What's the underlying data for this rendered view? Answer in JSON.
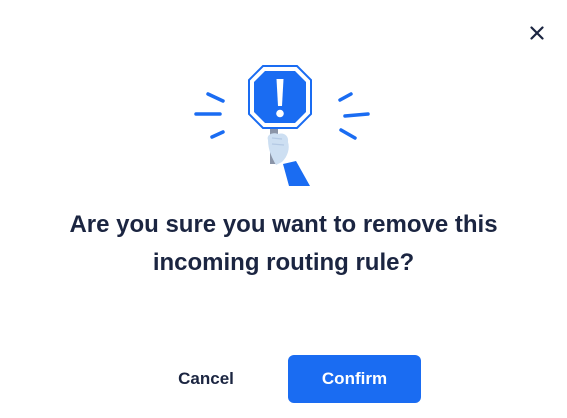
{
  "dialog": {
    "title": "Are you sure you want to remove this incoming routing rule?",
    "cancel_label": "Cancel",
    "confirm_label": "Confirm",
    "close_icon": "close-icon",
    "illustration_icon": "warning-sign-icon"
  },
  "colors": {
    "primary": "#1a6cf2",
    "text": "#1b2541",
    "background": "#ffffff"
  }
}
